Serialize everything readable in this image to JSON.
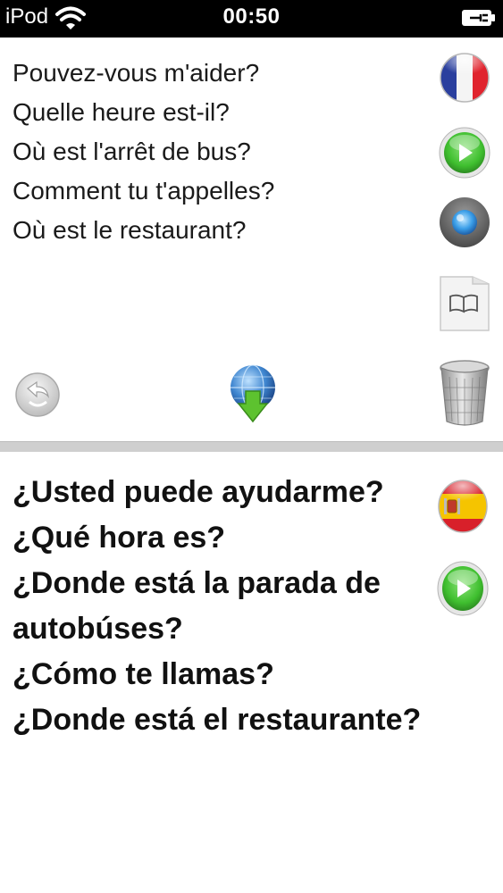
{
  "status_bar": {
    "carrier": "iPod",
    "time": "00:50"
  },
  "source": {
    "language_icon": "france-flag-icon",
    "phrases": [
      "Pouvez-vous m'aider?",
      "Quelle heure est-il?",
      "Où est l'arrêt de bus?",
      "Comment tu t'appelles?",
      "Où est le restaurant?"
    ]
  },
  "target": {
    "language_icon": "spain-flag-icon",
    "phrases": [
      "¿Usted puede ayudarme?",
      "¿Qué hora es?",
      "¿Donde está la parada de autobúses?",
      "¿Cómo te llamas?",
      "¿Donde está el restaurante?"
    ]
  },
  "icons": {
    "play_source": "play-icon",
    "record": "record-icon",
    "phrasebook": "book-icon",
    "share": "share-icon",
    "download": "download-globe-icon",
    "trash": "trash-icon",
    "play_target": "play-icon"
  },
  "colors": {
    "status_bar_bg": "#000000",
    "play_green": "#3fbf2f",
    "record_blue": "#3a9ee8",
    "divider": "#cfcfcf"
  }
}
